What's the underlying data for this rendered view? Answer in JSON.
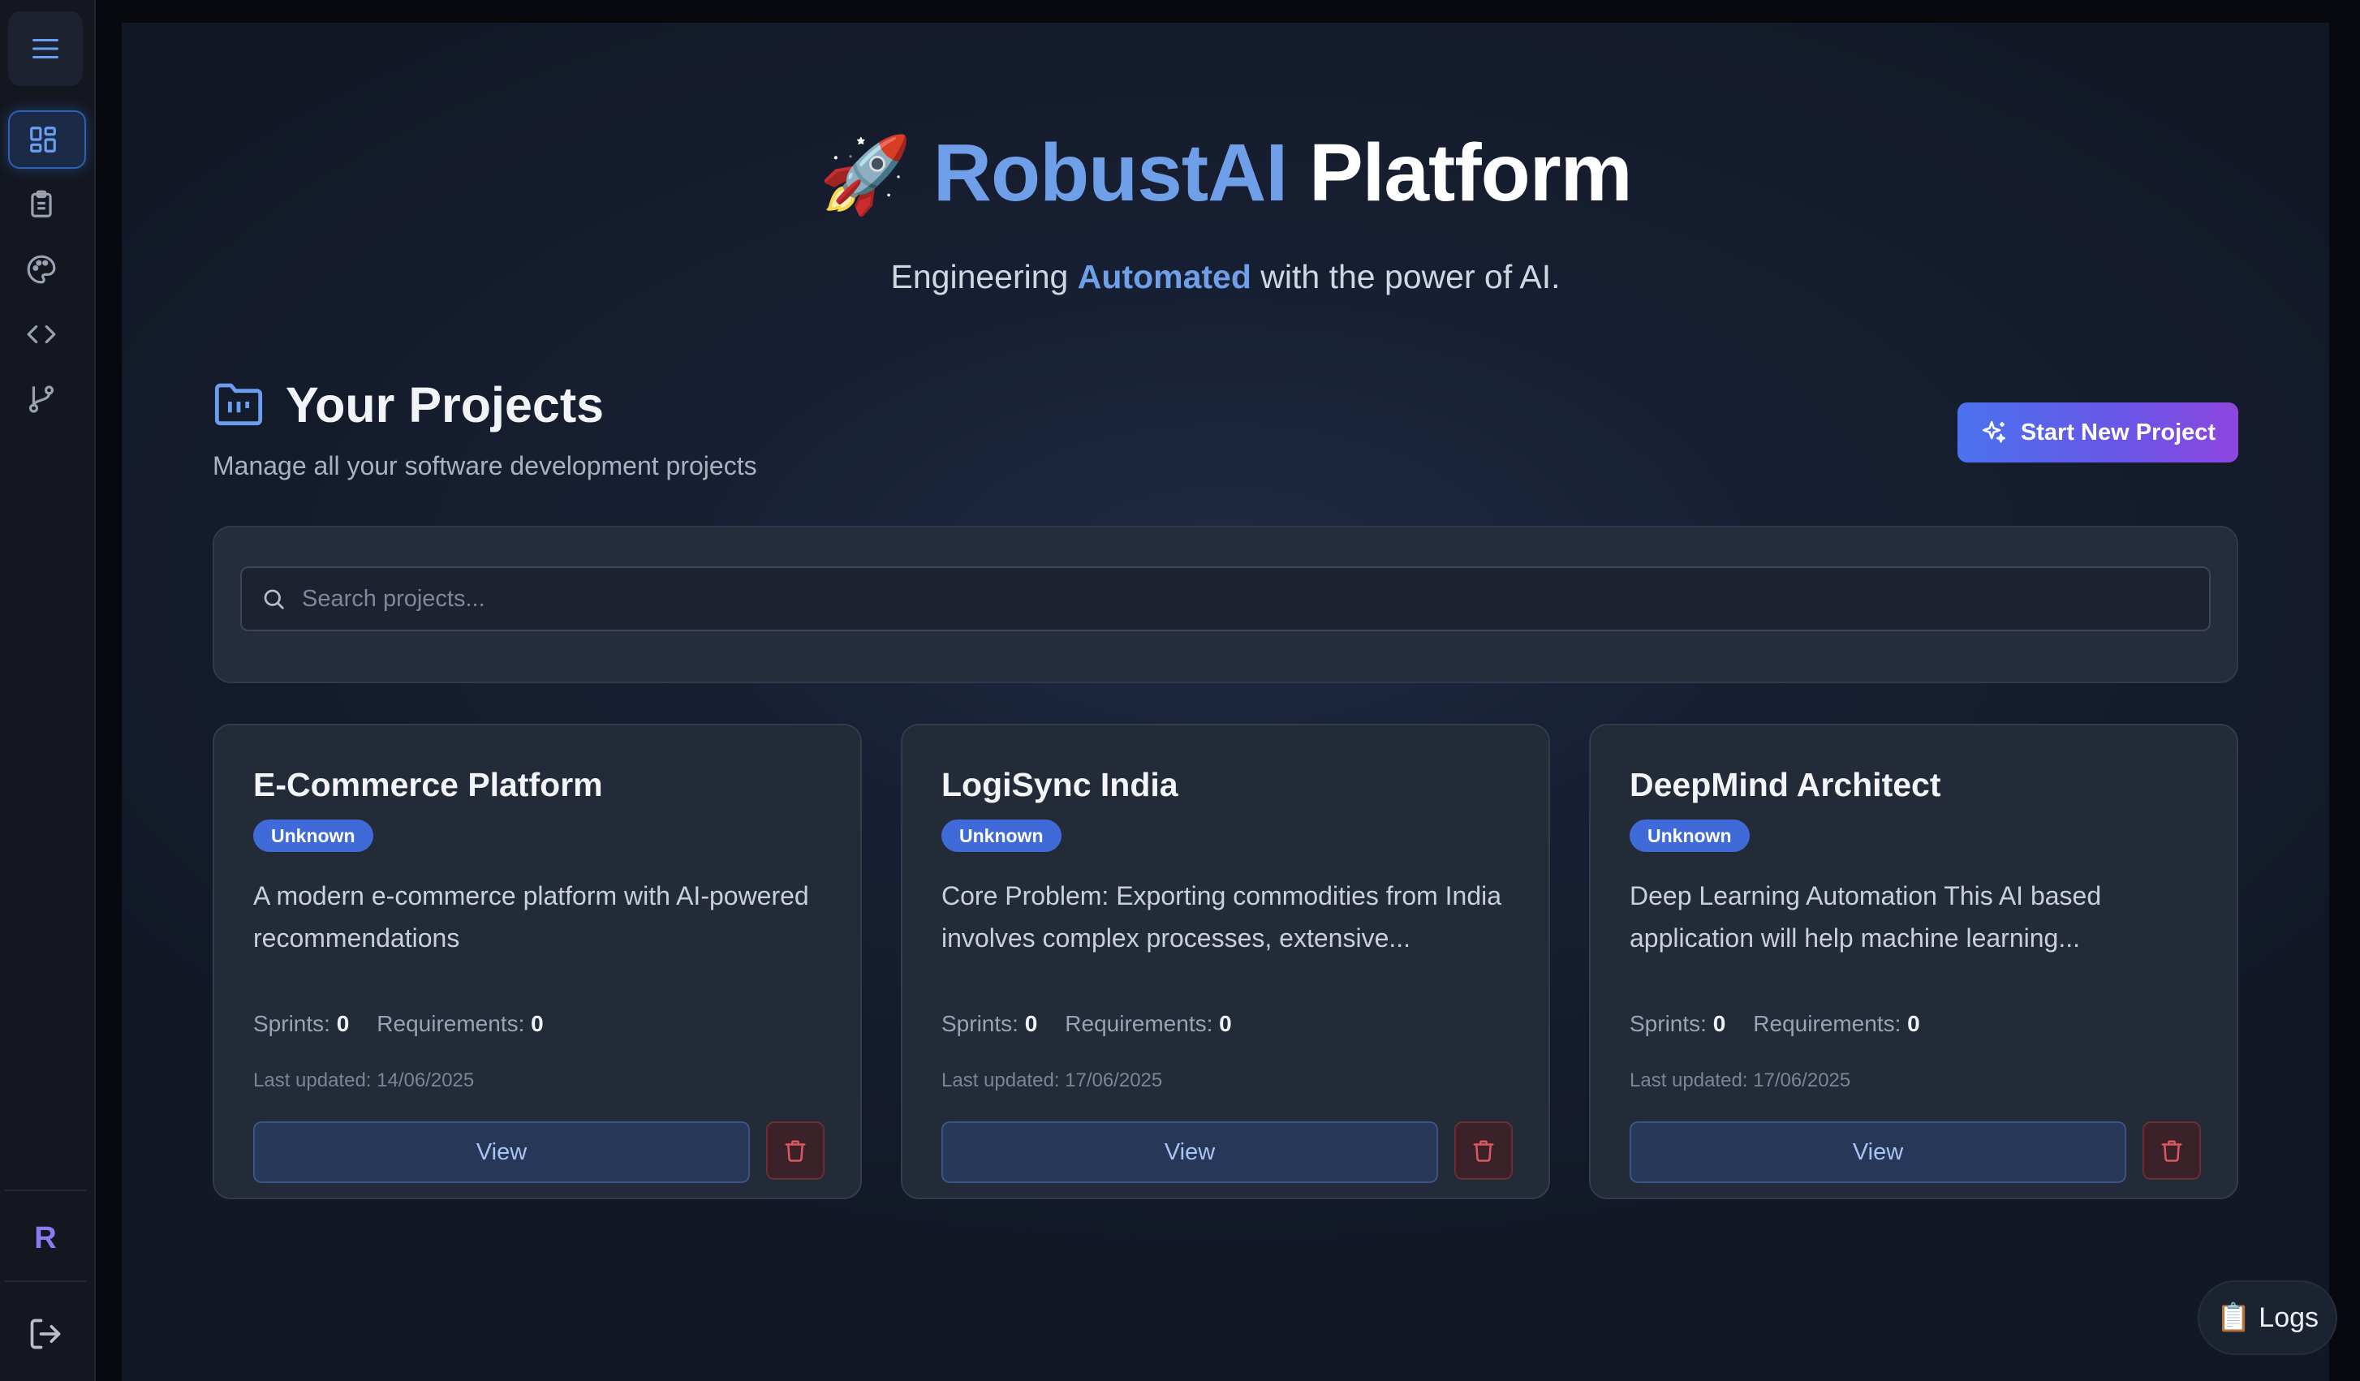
{
  "sidebar": {
    "menu_icon": "hamburger-menu-icon",
    "items": [
      {
        "name": "dashboard",
        "icon": "dashboard-grid-icon",
        "active": true
      },
      {
        "name": "requirements",
        "icon": "clipboard-icon",
        "active": false
      },
      {
        "name": "design",
        "icon": "palette-icon",
        "active": false
      },
      {
        "name": "code",
        "icon": "code-brackets-icon",
        "active": false
      },
      {
        "name": "git",
        "icon": "git-branch-icon",
        "active": false
      }
    ],
    "avatar_initial": "R",
    "logout_icon": "logout-icon"
  },
  "hero": {
    "emoji": "🚀",
    "brand": "RobustAI",
    "title_rest": "Platform",
    "sub_before": "Engineering",
    "sub_highlight": "Automated",
    "sub_after": "with the power of AI."
  },
  "projects": {
    "title": "Your Projects",
    "subtitle": "Manage all your software development projects",
    "start_button": "Start New Project",
    "search_placeholder": "Search projects...",
    "cards": [
      {
        "title": "E-Commerce Platform",
        "status": "Unknown",
        "description": "A modern e-commerce platform with AI-powered recommendations",
        "sprints_label": "Sprints:",
        "sprints": "0",
        "requirements_label": "Requirements:",
        "requirements": "0",
        "updated": "Last updated: 14/06/2025",
        "view_label": "View"
      },
      {
        "title": "LogiSync India",
        "status": "Unknown",
        "description": "Core Problem: Exporting commodities from India involves complex processes, extensive...",
        "sprints_label": "Sprints:",
        "sprints": "0",
        "requirements_label": "Requirements:",
        "requirements": "0",
        "updated": "Last updated: 17/06/2025",
        "view_label": "View"
      },
      {
        "title": "DeepMind Architect",
        "status": "Unknown",
        "description": "Deep Learning Automation This AI based application will help machine learning...",
        "sprints_label": "Sprints:",
        "sprints": "0",
        "requirements_label": "Requirements:",
        "requirements": "0",
        "updated": "Last updated: 17/06/2025",
        "view_label": "View"
      }
    ]
  },
  "logs": {
    "emoji": "📋",
    "label": "Logs"
  },
  "colors": {
    "accent": "#6e9fe8",
    "badge": "#3f6ad8",
    "button_gradient_start": "#4a72ee",
    "button_gradient_end": "#8e46df",
    "delete": "#e05561"
  }
}
